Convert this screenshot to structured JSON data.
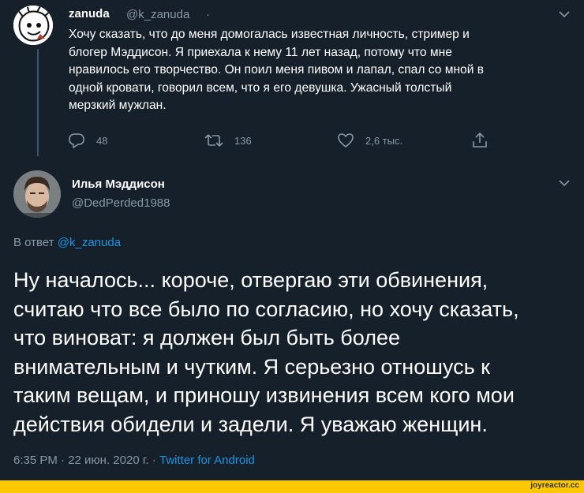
{
  "tweet": {
    "author_name": "zanuda",
    "author_handle": "@k_zanuda",
    "separator": "·",
    "text": "Хочу сказать, что до меня домогалась известная личность, стример и\nблогер Мэддисон. Я приехала к нему 11 лет назад, потому что мне\nнравилось его творчество. Он поил меня пивом и лапал, спал со мной в\nодной кровати, говорил всем, что я его девушка. Ужасный толстый\nмерзкий мужлан.",
    "actions": {
      "reply_count": "48",
      "retweet_count": "136",
      "like_count": "2,6 тыс."
    }
  },
  "reply": {
    "author_name": "Илья Мэддисон",
    "author_handle": "@DedPerded1988",
    "reply_to_label": "В ответ",
    "reply_to_handle": "@k_zanuda",
    "text": "Ну началось...  короче, отвергаю эти обвинения,\nсчитаю что все было по согласию, но хочу сказать,\nчто виноват: я должен был быть более\nвнимательным и чутким. Я серьезно отношусь к\nтаким вещам, и приношу извинения всем кого мои\nдействия обидели и задели. Я уважаю женщин.",
    "timestamp": "6:35 PM · 22 июн. 2020 г. ·",
    "source": "Twitter for Android"
  },
  "watermark": "joyreactor.cc",
  "colors": {
    "background": "#15202b",
    "secondary_text": "#8899a6",
    "link": "#1b95e0",
    "footer_bar": "#ffc700"
  }
}
